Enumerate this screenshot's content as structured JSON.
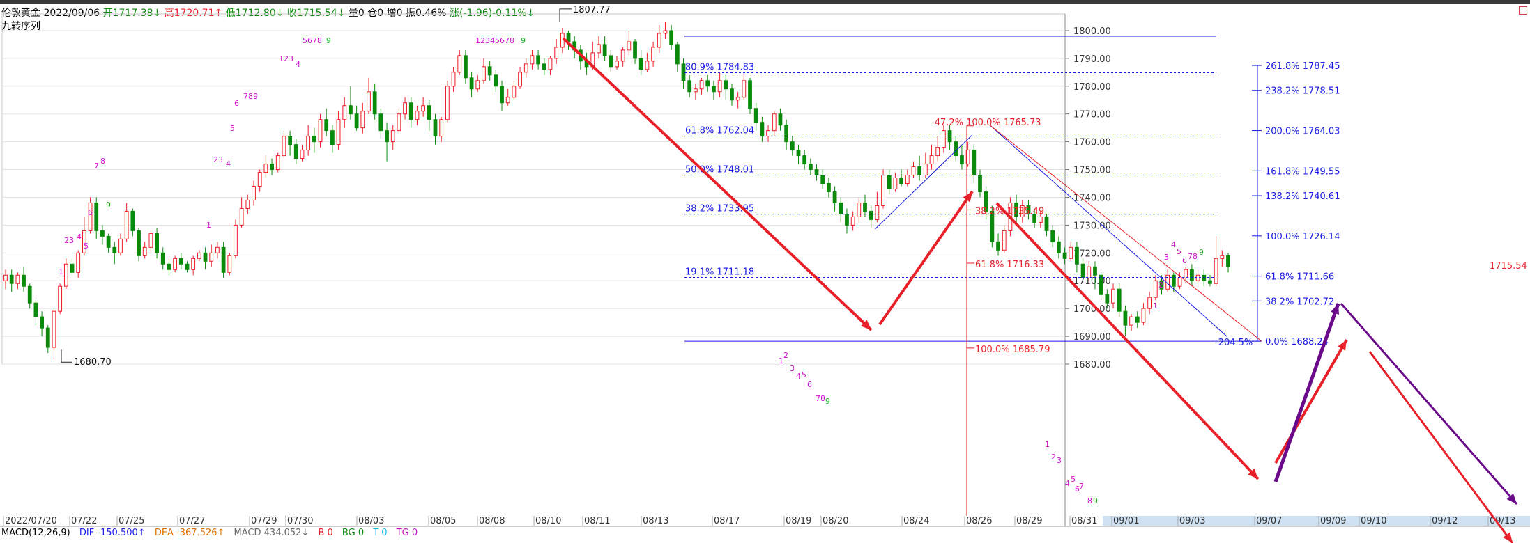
{
  "header": {
    "name": "伦敦黄金",
    "date": "2022/09/06",
    "open": "开1717.38↓",
    "high": "高1720.71↑",
    "low": "低1712.80↓",
    "close": "收1715.54↓",
    "volume": "量0",
    "position": "仓0",
    "increase": "增0",
    "amplitude": "振0.46%",
    "change": "涨(-1.96)-0.11%↓"
  },
  "indicator_title": "九转序列",
  "footer": {
    "macd": "MACD(12,26,9)",
    "dif": "DIF -150.500↑",
    "dea": "DEA -367.526↑",
    "macd_val": "MACD 434.052↓",
    "b": "B 0",
    "bg": "BG 0",
    "t": "T 0",
    "tg": "TG 0"
  },
  "colors": {
    "up": "#ee1c24",
    "down": "#0a8a0a",
    "fib": "#1a1ae6",
    "red": "#e8202a",
    "purple": "#6a0a8a",
    "magenta": "#d010d0",
    "green": "#20b020"
  },
  "chart_data": {
    "type": "candlestick",
    "ylim": [
      1680,
      1806
    ],
    "yticks": [
      "1800.00",
      "1790.00",
      "1780.00",
      "1770.00",
      "1760.00",
      "1750.00",
      "1740.00",
      "1730.00",
      "1720.00",
      "1710.00",
      "1700.00",
      "1690.00",
      "1680.00"
    ],
    "current_price": "1715.54",
    "xlabels": [
      "2022/07/20",
      "07/22",
      "07/25",
      "07/27",
      "07/29",
      "07/30",
      "08/03",
      "08/05",
      "08/08",
      "08/10",
      "08/11",
      "08/13",
      "08/17",
      "08/19",
      "08/20",
      "08/24",
      "08/26",
      "08/29",
      "08/31",
      "09/01",
      "09/03",
      "09/07",
      "09/09",
      "09/10",
      "09/12",
      "09/13"
    ],
    "candles": [
      [
        1710,
        1712,
        1714,
        1707
      ],
      [
        1712,
        1709,
        1714,
        1706
      ],
      [
        1709,
        1712,
        1713,
        1707
      ],
      [
        1712,
        1708,
        1715,
        1706
      ],
      [
        1708,
        1702,
        1709,
        1700
      ],
      [
        1702,
        1697,
        1703,
        1694
      ],
      [
        1697,
        1693,
        1699,
        1690
      ],
      [
        1693,
        1686,
        1694,
        1684
      ],
      [
        1686,
        1699,
        1700,
        1681
      ],
      [
        1699,
        1708,
        1709,
        1698
      ],
      [
        1708,
        1716,
        1718,
        1707
      ],
      [
        1716,
        1713,
        1718,
        1711
      ],
      [
        1713,
        1720,
        1721,
        1711
      ],
      [
        1720,
        1728,
        1733,
        1719
      ],
      [
        1728,
        1738,
        1740,
        1727
      ],
      [
        1738,
        1728,
        1740,
        1725
      ],
      [
        1728,
        1726,
        1730,
        1723
      ],
      [
        1726,
        1722,
        1727,
        1720
      ],
      [
        1722,
        1720,
        1724,
        1716
      ],
      [
        1720,
        1725,
        1727,
        1719
      ],
      [
        1725,
        1735,
        1738,
        1724
      ],
      [
        1735,
        1728,
        1736,
        1726
      ],
      [
        1728,
        1719,
        1729,
        1717
      ],
      [
        1719,
        1722,
        1724,
        1718
      ],
      [
        1722,
        1727,
        1728,
        1720
      ],
      [
        1727,
        1720,
        1729,
        1718
      ],
      [
        1720,
        1716,
        1722,
        1714
      ],
      [
        1716,
        1714,
        1718,
        1712
      ],
      [
        1714,
        1718,
        1719,
        1713
      ],
      [
        1718,
        1716,
        1720,
        1714
      ],
      [
        1716,
        1714,
        1717,
        1713
      ],
      [
        1714,
        1718,
        1719,
        1712
      ],
      [
        1718,
        1720,
        1721,
        1717
      ],
      [
        1720,
        1717,
        1722,
        1714
      ],
      [
        1717,
        1720,
        1723,
        1715
      ],
      [
        1720,
        1722,
        1724,
        1718
      ],
      [
        1722,
        1713,
        1724,
        1711
      ],
      [
        1713,
        1719,
        1720,
        1712
      ],
      [
        1719,
        1730,
        1732,
        1718
      ],
      [
        1730,
        1736,
        1740,
        1729
      ],
      [
        1736,
        1739,
        1741,
        1734
      ],
      [
        1739,
        1744,
        1746,
        1737
      ],
      [
        1744,
        1749,
        1750,
        1742
      ],
      [
        1749,
        1752,
        1755,
        1747
      ],
      [
        1752,
        1750,
        1754,
        1748
      ],
      [
        1750,
        1755,
        1756,
        1749
      ],
      [
        1755,
        1762,
        1764,
        1754
      ],
      [
        1762,
        1759,
        1764,
        1755
      ],
      [
        1759,
        1754,
        1761,
        1752
      ],
      [
        1754,
        1757,
        1759,
        1753
      ],
      [
        1757,
        1762,
        1766,
        1755
      ],
      [
        1762,
        1760,
        1765,
        1756
      ],
      [
        1760,
        1768,
        1770,
        1758
      ],
      [
        1768,
        1764,
        1772,
        1762
      ],
      [
        1764,
        1759,
        1766,
        1756
      ],
      [
        1759,
        1768,
        1771,
        1757
      ],
      [
        1768,
        1773,
        1776,
        1765
      ],
      [
        1773,
        1770,
        1780,
        1768
      ],
      [
        1770,
        1765,
        1773,
        1764
      ],
      [
        1765,
        1771,
        1774,
        1763
      ],
      [
        1771,
        1778,
        1783,
        1770
      ],
      [
        1778,
        1770,
        1781,
        1768
      ],
      [
        1770,
        1764,
        1772,
        1761
      ],
      [
        1764,
        1760,
        1767,
        1753
      ],
      [
        1760,
        1764,
        1766,
        1757
      ],
      [
        1764,
        1770,
        1772,
        1763
      ],
      [
        1770,
        1774,
        1776,
        1768
      ],
      [
        1774,
        1768,
        1776,
        1765
      ],
      [
        1768,
        1771,
        1773,
        1766
      ],
      [
        1771,
        1773,
        1776,
        1769
      ],
      [
        1773,
        1768,
        1775,
        1764
      ],
      [
        1768,
        1762,
        1770,
        1759
      ],
      [
        1762,
        1768,
        1769,
        1760
      ],
      [
        1768,
        1780,
        1782,
        1767
      ],
      [
        1780,
        1785,
        1787,
        1778
      ],
      [
        1785,
        1791,
        1793,
        1784
      ],
      [
        1791,
        1783,
        1793,
        1781
      ],
      [
        1783,
        1779,
        1785,
        1776
      ],
      [
        1779,
        1782,
        1784,
        1778
      ],
      [
        1782,
        1787,
        1790,
        1781
      ],
      [
        1787,
        1784,
        1789,
        1782
      ],
      [
        1784,
        1780,
        1786,
        1778
      ],
      [
        1780,
        1774,
        1782,
        1771
      ],
      [
        1774,
        1776,
        1779,
        1773
      ],
      [
        1776,
        1780,
        1782,
        1775
      ],
      [
        1780,
        1785,
        1787,
        1779
      ],
      [
        1785,
        1788,
        1790,
        1783
      ],
      [
        1788,
        1791,
        1793,
        1786
      ],
      [
        1791,
        1788,
        1793,
        1786
      ],
      [
        1788,
        1786,
        1790,
        1784
      ],
      [
        1786,
        1790,
        1791,
        1784
      ],
      [
        1790,
        1794,
        1797,
        1788
      ],
      [
        1794,
        1799,
        1801,
        1792
      ],
      [
        1799,
        1796,
        1800,
        1793
      ],
      [
        1796,
        1793,
        1798,
        1790
      ],
      [
        1793,
        1789,
        1795,
        1786
      ],
      [
        1789,
        1787,
        1792,
        1784
      ],
      [
        1787,
        1792,
        1796,
        1786
      ],
      [
        1792,
        1795,
        1798,
        1790
      ],
      [
        1795,
        1791,
        1798,
        1789
      ],
      [
        1791,
        1787,
        1793,
        1785
      ],
      [
        1787,
        1789,
        1791,
        1786
      ],
      [
        1789,
        1793,
        1794,
        1787
      ],
      [
        1793,
        1796,
        1800,
        1791
      ],
      [
        1796,
        1790,
        1797,
        1788
      ],
      [
        1790,
        1786,
        1793,
        1784
      ],
      [
        1786,
        1789,
        1792,
        1785
      ],
      [
        1789,
        1794,
        1796,
        1787
      ],
      [
        1794,
        1799,
        1802,
        1792
      ],
      [
        1799,
        1800,
        1803,
        1797
      ],
      [
        1800,
        1795,
        1802,
        1793
      ],
      [
        1795,
        1788,
        1796,
        1785
      ],
      [
        1788,
        1782,
        1790,
        1779
      ],
      [
        1782,
        1778,
        1784,
        1776
      ],
      [
        1778,
        1779,
        1781,
        1775
      ],
      [
        1779,
        1782,
        1783,
        1777
      ],
      [
        1782,
        1780,
        1784,
        1778
      ],
      [
        1780,
        1778,
        1782,
        1775
      ],
      [
        1778,
        1782,
        1785,
        1776
      ],
      [
        1782,
        1779,
        1784,
        1775
      ],
      [
        1779,
        1775,
        1781,
        1773
      ],
      [
        1775,
        1776,
        1778,
        1772
      ],
      [
        1776,
        1782,
        1785,
        1775
      ],
      [
        1782,
        1772,
        1783,
        1770
      ],
      [
        1772,
        1767,
        1774,
        1764
      ],
      [
        1767,
        1762,
        1769,
        1760
      ],
      [
        1762,
        1764,
        1766,
        1760
      ],
      [
        1764,
        1770,
        1771,
        1762
      ],
      [
        1770,
        1766,
        1772,
        1764
      ],
      [
        1766,
        1760,
        1768,
        1757
      ],
      [
        1760,
        1757,
        1762,
        1755
      ],
      [
        1757,
        1755,
        1759,
        1752
      ],
      [
        1755,
        1752,
        1757,
        1750
      ],
      [
        1752,
        1750,
        1754,
        1748
      ],
      [
        1750,
        1748,
        1752,
        1746
      ],
      [
        1748,
        1745,
        1750,
        1743
      ],
      [
        1745,
        1742,
        1747,
        1740
      ],
      [
        1742,
        1738,
        1744,
        1735
      ],
      [
        1738,
        1734,
        1740,
        1731
      ],
      [
        1734,
        1730,
        1736,
        1727
      ],
      [
        1730,
        1733,
        1735,
        1728
      ],
      [
        1733,
        1738,
        1740,
        1731
      ],
      [
        1738,
        1735,
        1741,
        1733
      ],
      [
        1735,
        1732,
        1737,
        1729
      ],
      [
        1732,
        1737,
        1742,
        1731
      ],
      [
        1737,
        1748,
        1750,
        1736
      ],
      [
        1748,
        1743,
        1750,
        1741
      ],
      [
        1743,
        1747,
        1749,
        1742
      ],
      [
        1747,
        1745,
        1750,
        1744
      ],
      [
        1745,
        1748,
        1750,
        1744
      ],
      [
        1748,
        1751,
        1753,
        1747
      ],
      [
        1751,
        1748,
        1755,
        1746
      ],
      [
        1748,
        1752,
        1756,
        1747
      ],
      [
        1752,
        1755,
        1759,
        1750
      ],
      [
        1755,
        1758,
        1762,
        1753
      ],
      [
        1758,
        1764,
        1766,
        1756
      ],
      [
        1764,
        1760,
        1766,
        1757
      ],
      [
        1760,
        1755,
        1762,
        1753
      ],
      [
        1755,
        1752,
        1759,
        1750
      ],
      [
        1752,
        1757,
        1760,
        1751
      ],
      [
        1757,
        1748,
        1759,
        1745
      ],
      [
        1748,
        1742,
        1750,
        1740
      ],
      [
        1742,
        1735,
        1744,
        1732
      ],
      [
        1735,
        1724,
        1737,
        1722
      ],
      [
        1724,
        1721,
        1727,
        1719
      ],
      [
        1721,
        1728,
        1730,
        1720
      ],
      [
        1728,
        1738,
        1740,
        1726
      ],
      [
        1738,
        1733,
        1741,
        1731
      ],
      [
        1733,
        1737,
        1739,
        1731
      ],
      [
        1737,
        1734,
        1739,
        1732
      ],
      [
        1734,
        1731,
        1736,
        1729
      ],
      [
        1731,
        1733,
        1735,
        1729
      ],
      [
        1733,
        1728,
        1734,
        1726
      ],
      [
        1728,
        1724,
        1730,
        1722
      ],
      [
        1724,
        1720,
        1726,
        1718
      ],
      [
        1720,
        1718,
        1722,
        1716
      ],
      [
        1718,
        1722,
        1724,
        1717
      ],
      [
        1722,
        1716,
        1724,
        1713
      ],
      [
        1716,
        1711,
        1718,
        1709
      ],
      [
        1711,
        1715,
        1717,
        1710
      ],
      [
        1715,
        1712,
        1717,
        1707
      ],
      [
        1712,
        1705,
        1713,
        1703
      ],
      [
        1705,
        1702,
        1707,
        1700
      ],
      [
        1702,
        1707,
        1709,
        1700
      ],
      [
        1707,
        1699,
        1709,
        1697
      ],
      [
        1699,
        1694,
        1701,
        1690
      ],
      [
        1694,
        1697,
        1698,
        1692
      ],
      [
        1697,
        1695,
        1699,
        1693
      ],
      [
        1695,
        1700,
        1702,
        1694
      ],
      [
        1700,
        1704,
        1706,
        1698
      ],
      [
        1704,
        1710,
        1712,
        1703
      ],
      [
        1710,
        1707,
        1712,
        1705
      ],
      [
        1707,
        1712,
        1714,
        1706
      ],
      [
        1712,
        1708,
        1713,
        1706
      ],
      [
        1708,
        1711,
        1713,
        1707
      ],
      [
        1711,
        1714,
        1715,
        1709
      ],
      [
        1714,
        1710,
        1716,
        1708
      ],
      [
        1710,
        1712,
        1714,
        1709
      ],
      [
        1712,
        1710,
        1714,
        1708
      ],
      [
        1710,
        1709,
        1712,
        1708
      ],
      [
        1709,
        1718,
        1726,
        1708
      ],
      [
        1718,
        1719,
        1721,
        1715
      ],
      [
        1719,
        1715,
        1720,
        1713
      ]
    ],
    "fib_left": [
      {
        "label": "80.9% 1784.83",
        "value": 1784.83
      },
      {
        "label": "61.8% 1762.04",
        "value": 1762.04
      },
      {
        "label": "50.0% 1748.01",
        "value": 1748.01
      },
      {
        "label": "38.2% 1733.95",
        "value": 1733.95
      },
      {
        "label": "19.1% 1711.18",
        "value": 1711.18
      }
    ],
    "fib_right": [
      {
        "label": "261.8% 1787.45",
        "value": 1787.45
      },
      {
        "label": "238.2% 1778.51",
        "value": 1778.51
      },
      {
        "label": "200.0% 1764.03",
        "value": 1764.03
      },
      {
        "label": "161.8% 1749.55",
        "value": 1749.55
      },
      {
        "label": "138.2% 1740.61",
        "value": 1740.61
      },
      {
        "label": "100.0% 1726.14",
        "value": 1726.14
      },
      {
        "label": "61.8% 1711.66",
        "value": 1711.66
      },
      {
        "label": "38.2% 1702.72",
        "value": 1702.72
      },
      {
        "label": "0.0% 1688.24",
        "value": 1688.24
      }
    ],
    "fib_red": [
      {
        "label": "-47.2% 100.0% 1765.73",
        "value": 1765.73
      },
      {
        "label": "38.2% 1735.49",
        "value": 1735.49
      },
      {
        "label": "61.8% 1716.33",
        "value": 1716.33
      },
      {
        "label": "100.0% 1685.79",
        "value": 1685.79
      }
    ],
    "fib_ext_label": "-204.5%",
    "high_label": "1807.77",
    "low_label": "1680.70",
    "td_counts": [
      {
        "text": "5678",
        "color": "magenta"
      },
      {
        "text": "9",
        "color": "green"
      },
      {
        "text": "12345678",
        "color": "magenta"
      },
      {
        "text": "9",
        "color": "green"
      },
      {
        "text": "1234",
        "color": "magenta"
      },
      {
        "text": "789",
        "color": "magenta"
      },
      {
        "text": "1",
        "color": "magenta"
      },
      {
        "text": "2",
        "color": "magenta"
      },
      {
        "text": "3",
        "color": "magenta"
      },
      {
        "text": "4",
        "color": "magenta"
      },
      {
        "text": "5",
        "color": "magenta"
      },
      {
        "text": "6",
        "color": "magenta"
      },
      {
        "text": "7",
        "color": "magenta"
      },
      {
        "text": "8",
        "color": "magenta"
      }
    ]
  }
}
